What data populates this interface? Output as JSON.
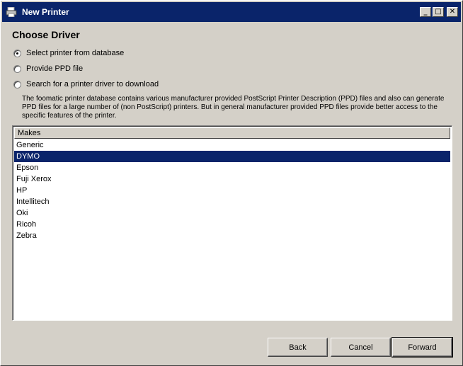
{
  "window": {
    "title": "New Printer",
    "icon": "printer-icon",
    "controls": {
      "minimize": "_",
      "maximize": "□",
      "close": "✕"
    }
  },
  "heading": "Choose Driver",
  "radios": [
    {
      "label": "Select printer from database",
      "checked": true
    },
    {
      "label": "Provide PPD file",
      "checked": false
    },
    {
      "label": "Search for a printer driver to download",
      "checked": false
    }
  ],
  "description": "The foomatic printer database contains various manufacturer provided PostScript Printer Description (PPD) files and also can generate PPD files for a large number of (non PostScript) printers. But in general manufacturer provided PPD files provide better access to the specific features of the printer.",
  "list": {
    "header": "Makes",
    "items": [
      "Generic",
      "DYMO",
      "Epson",
      "Fuji Xerox",
      "HP",
      "Intellitech",
      "Oki",
      "Ricoh",
      "Zebra"
    ],
    "selected": "DYMO"
  },
  "buttons": {
    "back": "Back",
    "cancel": "Cancel",
    "forward": "Forward"
  },
  "colors": {
    "titlebar": "#0a246a",
    "selection": "#0a246a",
    "face": "#d4d0c8"
  }
}
